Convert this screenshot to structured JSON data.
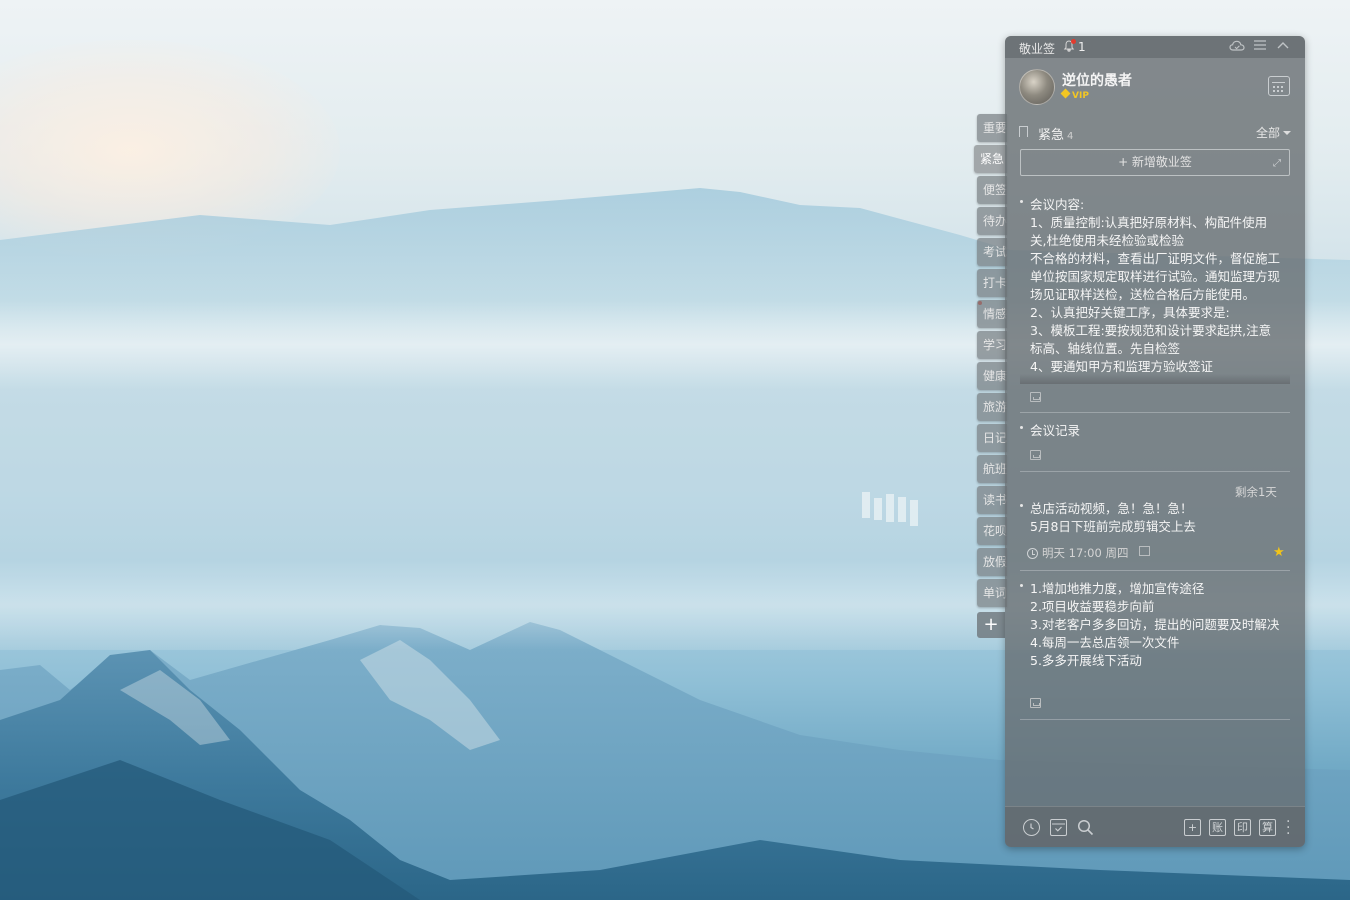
{
  "colors": {
    "panel_bg": "#686e72",
    "accent_red": "#e23b2e",
    "vip_gold": "#f3c623",
    "star_gold": "#f2c418"
  },
  "app": {
    "name": "敬业签",
    "notification_count": "1"
  },
  "user": {
    "name": "逆位的愚者",
    "badge": "VIP"
  },
  "tabs": [
    {
      "label": "重要"
    },
    {
      "label": "紧急",
      "active": true
    },
    {
      "label": "便签"
    },
    {
      "label": "待办"
    },
    {
      "label": "考试"
    },
    {
      "label": "打卡"
    },
    {
      "label": "情感"
    },
    {
      "label": "学习"
    },
    {
      "label": "健康"
    },
    {
      "label": "旅游"
    },
    {
      "label": "日记"
    },
    {
      "label": "航班"
    },
    {
      "label": "读书"
    },
    {
      "label": "花呗"
    },
    {
      "label": "放假"
    },
    {
      "label": "单词"
    }
  ],
  "tab_add": "+",
  "category": {
    "name": "紧急",
    "count": "4",
    "filter": "全部"
  },
  "add_button": "+ 新增敬业签",
  "notes": [
    {
      "text": "会议内容:\n1、质量控制:认真把好原材料、构配件使用关,杜绝使用未经检验或检验\n不合格的材料，查看出厂证明文件，督促施工单位按国家规定取样进行试验。通知监理方现场见证取样送检，送检合格后方能使用。\n2、认真把好关键工序，具体要求是:\n3、模板工程:要按规范和设计要求起拱,注意标高、轴线位置。先自检签\n4、要通知甲方和监理方验收签证"
    },
    {
      "text": "会议记录"
    },
    {
      "remaining": "剩余1天",
      "text": "总店活动视频，急！急！急！\n5月8日下班前完成剪辑交上去",
      "reminder": "明天 17:00 周四"
    },
    {
      "text": "1.增加地推力度，增加宣传途径\n2.项目收益要稳步向前\n3.对老客户多多回访，提出的问题要及时解决\n4.每周一去总店领一次文件\n5.多多开展线下活动"
    }
  ],
  "bottom_bar": {
    "add": "+",
    "account": "账",
    "print": "印",
    "calc": "算"
  }
}
